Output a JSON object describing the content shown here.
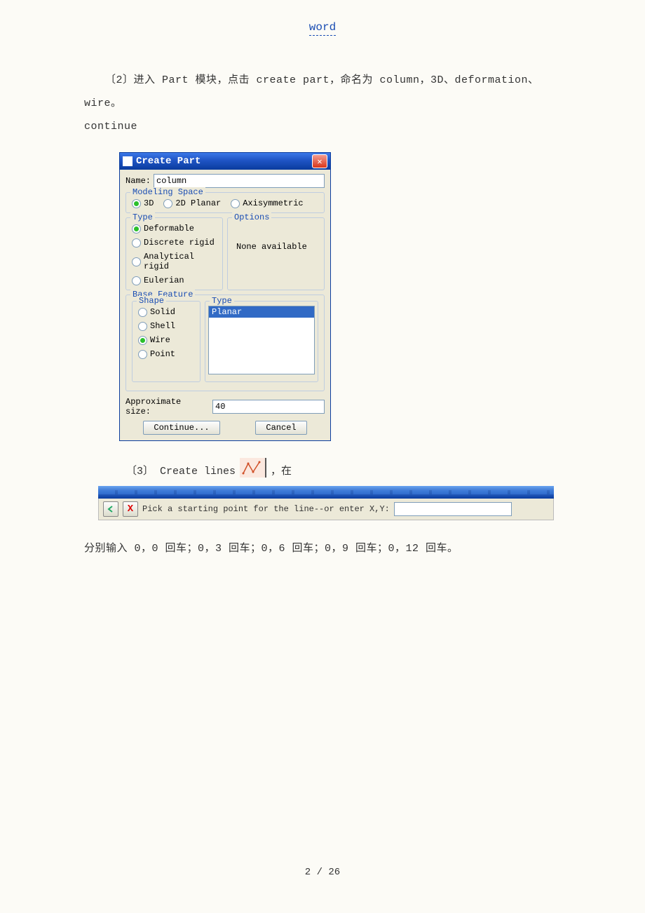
{
  "header_link": "word",
  "para1_line1": "〔2〕进入 Part 模块，点击 create part，命名为 column，3D、deformation、wire。",
  "para1_line2": "continue",
  "dialog": {
    "title": "Create Part",
    "name_label": "Name:",
    "name_value": "column",
    "modeling_space_title": "Modeling Space",
    "ms_3d": "3D",
    "ms_2d": "2D Planar",
    "ms_axi": "Axisymmetric",
    "type_title": "Type",
    "type_deformable": "Deformable",
    "type_discrete": "Discrete rigid",
    "type_analytical": "Analytical rigid",
    "type_eulerian": "Eulerian",
    "options_title": "Options",
    "options_text": "None available",
    "base_feature_title": "Base Feature",
    "shape_title": "Shape",
    "shape_solid": "Solid",
    "shape_shell": "Shell",
    "shape_wire": "Wire",
    "shape_point": "Point",
    "type2_title": "Type",
    "type2_planar": "Planar",
    "approx_label": "Approximate size:",
    "approx_value": "40",
    "continue_btn": "Continue...",
    "cancel_btn": "Cancel"
  },
  "para3_prefix": "〔3〕 Create lines",
  "para3_suffix": "，在",
  "prompt": {
    "text": "Pick a starting point for the line--or enter X,Y:",
    "value": ""
  },
  "para4": "分别输入 0，0 回车；0，3 回车；0，6 回车；0，9 回车；0，12 回车。",
  "page_number": "2 / 26"
}
